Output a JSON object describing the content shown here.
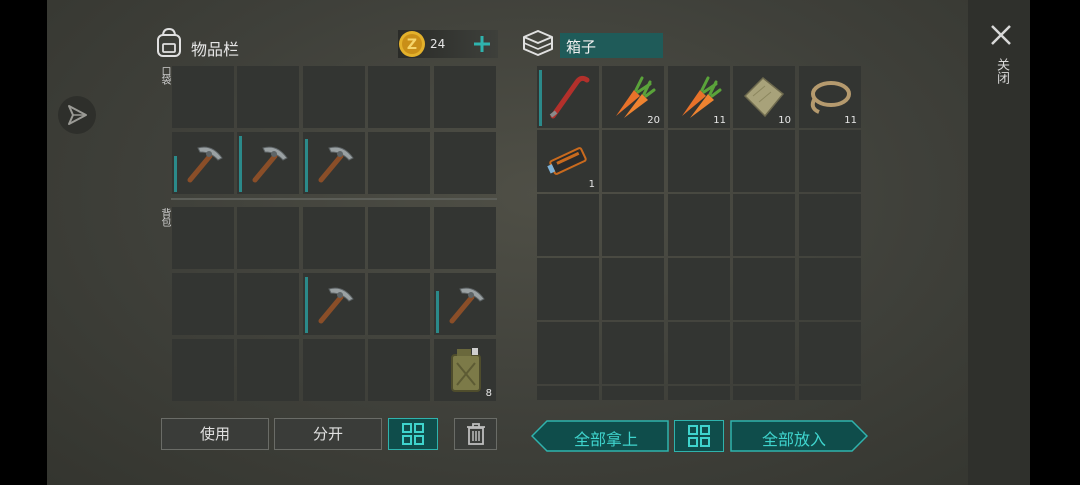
{
  "inventory": {
    "title": "物品栏",
    "coins": "24",
    "pocket_label": "口袋",
    "backpack_label": "背包",
    "pocket_row2": [
      {
        "icon": "pickaxe-icon",
        "count": "",
        "durability": 0.65
      },
      {
        "icon": "pickaxe-icon",
        "count": "",
        "durability": 1.0
      },
      {
        "icon": "pickaxe-icon",
        "count": "",
        "durability": 0.95
      }
    ],
    "backpack_items": [
      {
        "icon": "pickaxe-icon",
        "count": "",
        "durability": 1.0
      },
      {
        "icon": "pickaxe-icon",
        "count": "",
        "durability": 0.75
      },
      {
        "icon": "fuel-can-icon",
        "count": "8"
      }
    ],
    "use_label": "使用",
    "split_label": "分开"
  },
  "box": {
    "title": "箱子",
    "items": [
      {
        "icon": "crowbar-icon",
        "count": "",
        "durability": 1.0
      },
      {
        "icon": "carrot-icon",
        "count": "20"
      },
      {
        "icon": "carrot-icon",
        "count": "11"
      },
      {
        "icon": "cloth-icon",
        "count": "10"
      },
      {
        "icon": "rope-icon",
        "count": "11"
      },
      {
        "icon": "battery-icon",
        "count": "1"
      }
    ],
    "take_all_label": "全部拿上",
    "put_all_label": "全部放入"
  },
  "close_label": "关闭",
  "colors": {
    "accent": "#2fb3ad",
    "coin": "#e3b12b",
    "slot": "#333532"
  }
}
